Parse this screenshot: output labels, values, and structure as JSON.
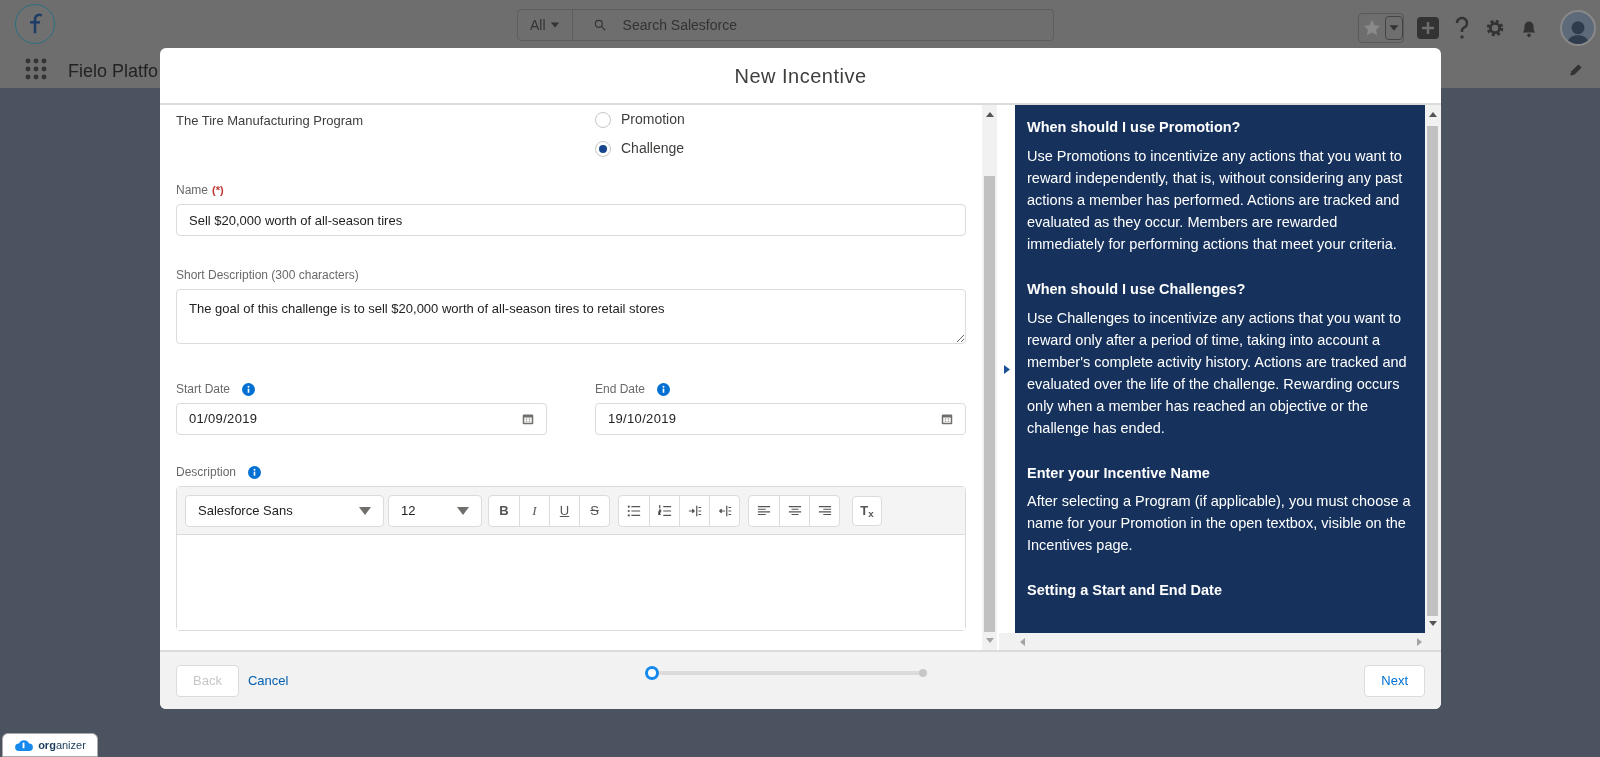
{
  "header": {
    "search_scope": "All",
    "search_placeholder": "Search Salesforce",
    "app_name": "Fielo Platfo"
  },
  "modal": {
    "title": "New Incentive",
    "program_text": "The Tire Manufacturing Program",
    "incentive_types": [
      {
        "label": "Promotion",
        "selected": false
      },
      {
        "label": "Challenge",
        "selected": true
      }
    ],
    "name_field": {
      "label": "Name",
      "required_mark": "(*)",
      "value": "Sell $20,000 worth of all-season tires"
    },
    "short_description": {
      "label": "Short Description (300 characters)",
      "value": "The goal of this challenge is to sell $20,000 worth of all-season tires to retail stores"
    },
    "start_date": {
      "label": "Start Date",
      "value": "01/09/2019"
    },
    "end_date": {
      "label": "End Date",
      "value": "19/10/2019"
    },
    "description": {
      "label": "Description",
      "font": "Salesforce Sans",
      "size": "12",
      "format_buttons": [
        {
          "kind": "bold",
          "label": "B"
        },
        {
          "kind": "italic",
          "label": "I"
        },
        {
          "kind": "underline",
          "label": "U"
        },
        {
          "kind": "strike",
          "label": "S"
        }
      ],
      "clear_button": "T$_{x}$"
    },
    "help_sections": [
      {
        "heading": "When should I use Promotion?",
        "body": "Use Promotions to incentivize any actions that you want to reward independently, that is, without considering any past actions a member has performed. Actions are tracked and evaluated as they occur. Members are rewarded immediately for performing actions that meet your criteria."
      },
      {
        "heading": "When should I use Challenges?",
        "body": "Use Challenges to incentivize any actions that you want to reward only after a period of time, taking into account a member's complete activity history. Actions are tracked and evaluated over the life of the challenge. Rewarding occurs only when a member has reached an objective or the challenge has ended."
      },
      {
        "heading": "Enter your Incentive Name",
        "body": "After selecting a Program (if applicable), you must choose a name for your Promotion in the open textbox, visible on the Incentives page."
      },
      {
        "heading": "Setting a Start and End Date"
      }
    ],
    "footer": {
      "back": {
        "label": "Back",
        "disabled": true
      },
      "cancel": "Cancel",
      "steps": [
        {
          "selected": true
        },
        {
          "selected": false
        }
      ],
      "next": "Next"
    }
  },
  "organizer_tab": "**org**anizer"
}
